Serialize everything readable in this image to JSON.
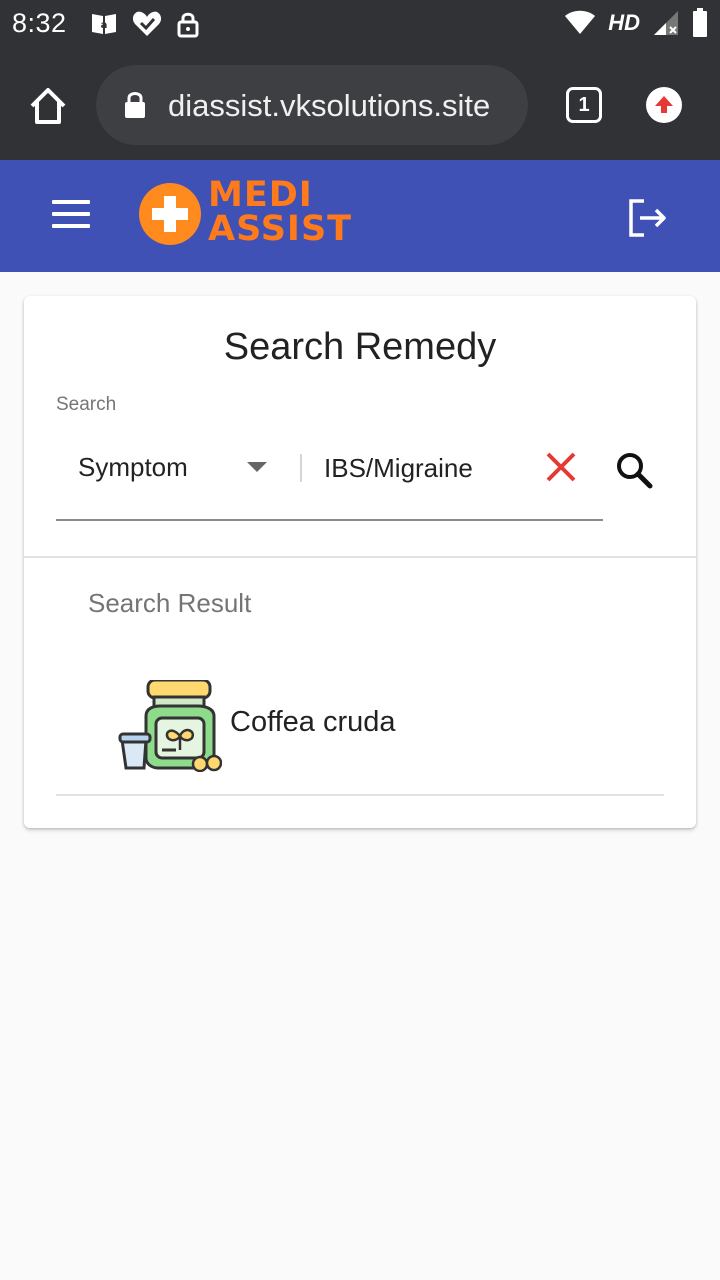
{
  "status_bar": {
    "time": "8:32",
    "network_label": "HD"
  },
  "browser": {
    "url": "diassist.vksolutions.site",
    "tab_count": "1"
  },
  "app_bar": {
    "logo_line1": "MEDI",
    "logo_line2": "ASSIST"
  },
  "search": {
    "title": "Search Remedy",
    "label": "Search",
    "type_selected": "Symptom",
    "query_value": "IBS/Migraine"
  },
  "results": {
    "label": "Search Result",
    "items": [
      {
        "name": "Coffea cruda"
      }
    ]
  },
  "colors": {
    "app_bar": "#3f51b5",
    "browser_chrome": "#313236",
    "logo_orange": "#ff7a1a",
    "clear_red": "#e53935"
  }
}
